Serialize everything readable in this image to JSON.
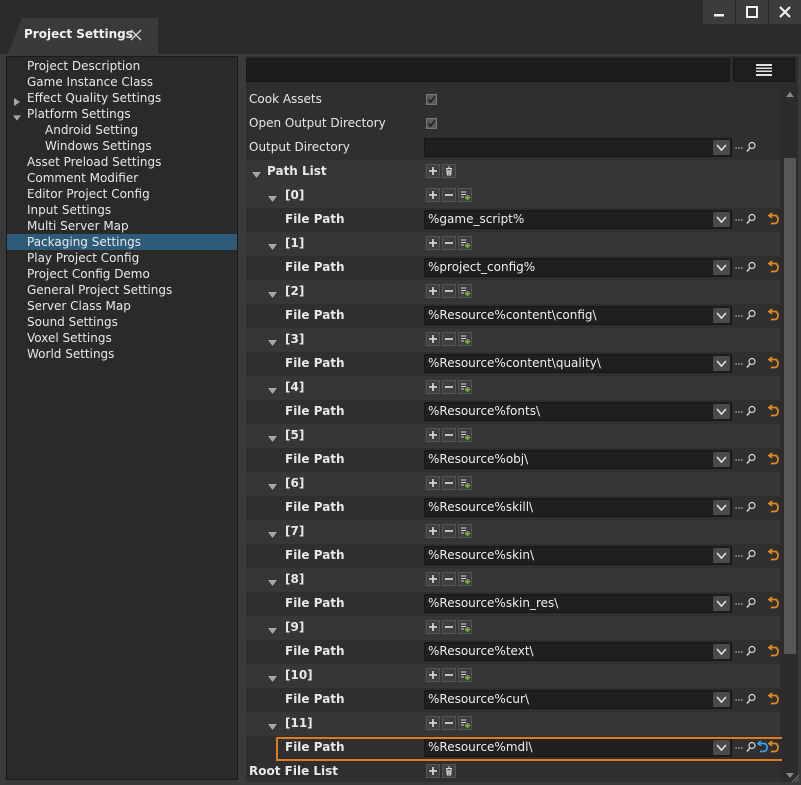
{
  "window": {
    "tab_title": "Project Settings"
  },
  "tree": {
    "items": [
      {
        "label": "Project Description",
        "indent": 0,
        "arrow": "none",
        "selected": false
      },
      {
        "label": "Game Instance Class",
        "indent": 0,
        "arrow": "none",
        "selected": false
      },
      {
        "label": "Effect Quality Settings",
        "indent": 0,
        "arrow": "collapsed",
        "selected": false
      },
      {
        "label": "Platform Settings",
        "indent": 0,
        "arrow": "expanded",
        "selected": false
      },
      {
        "label": "Android Setting",
        "indent": 1,
        "arrow": "none",
        "selected": false
      },
      {
        "label": "Windows Settings",
        "indent": 1,
        "arrow": "none",
        "selected": false
      },
      {
        "label": "Asset Preload Settings",
        "indent": 0,
        "arrow": "none",
        "selected": false
      },
      {
        "label": "Comment Modifier",
        "indent": 0,
        "arrow": "none",
        "selected": false
      },
      {
        "label": "Editor Project Config",
        "indent": 0,
        "arrow": "none",
        "selected": false
      },
      {
        "label": "Input Settings",
        "indent": 0,
        "arrow": "none",
        "selected": false
      },
      {
        "label": "Multi Server Map",
        "indent": 0,
        "arrow": "none",
        "selected": false
      },
      {
        "label": "Packaging Settings",
        "indent": 0,
        "arrow": "none",
        "selected": true
      },
      {
        "label": "Play Project Config",
        "indent": 0,
        "arrow": "none",
        "selected": false
      },
      {
        "label": "Project Config Demo",
        "indent": 0,
        "arrow": "none",
        "selected": false
      },
      {
        "label": "General Project Settings",
        "indent": 0,
        "arrow": "none",
        "selected": false
      },
      {
        "label": "Server Class Map",
        "indent": 0,
        "arrow": "none",
        "selected": false
      },
      {
        "label": "Sound Settings",
        "indent": 0,
        "arrow": "none",
        "selected": false
      },
      {
        "label": "Voxel Settings",
        "indent": 0,
        "arrow": "none",
        "selected": false
      },
      {
        "label": "World Settings",
        "indent": 0,
        "arrow": "none",
        "selected": false
      }
    ]
  },
  "properties": {
    "cook_assets": {
      "label": "Cook Assets",
      "checked": true
    },
    "open_output_directory": {
      "label": "Open Output Directory",
      "checked": true
    },
    "output_directory": {
      "label": "Output Directory",
      "value": ""
    },
    "path_list": {
      "label": "Path List",
      "element_key_label": "File Path",
      "entries": [
        {
          "index": "[0]",
          "path": "%game_script%"
        },
        {
          "index": "[1]",
          "path": "%project_config%"
        },
        {
          "index": "[2]",
          "path": "%Resource%content\\config\\"
        },
        {
          "index": "[3]",
          "path": "%Resource%content\\quality\\"
        },
        {
          "index": "[4]",
          "path": "%Resource%fonts\\"
        },
        {
          "index": "[5]",
          "path": "%Resource%obj\\"
        },
        {
          "index": "[6]",
          "path": "%Resource%skill\\"
        },
        {
          "index": "[7]",
          "path": "%Resource%skin\\"
        },
        {
          "index": "[8]",
          "path": "%Resource%skin_res\\"
        },
        {
          "index": "[9]",
          "path": "%Resource%text\\"
        },
        {
          "index": "[10]",
          "path": "%Resource%cur\\"
        },
        {
          "index": "[11]",
          "path": "%Resource%mdl\\"
        }
      ]
    },
    "root_file_list": {
      "label": "Root File List"
    }
  },
  "colors": {
    "selected_item": "#2f5b7a",
    "highlight_border": "#e07a1e",
    "reset_arrow": "#e08a1e",
    "reset_arrow_active": "#3aa0e8",
    "add_element_green": "#6abf3a"
  }
}
